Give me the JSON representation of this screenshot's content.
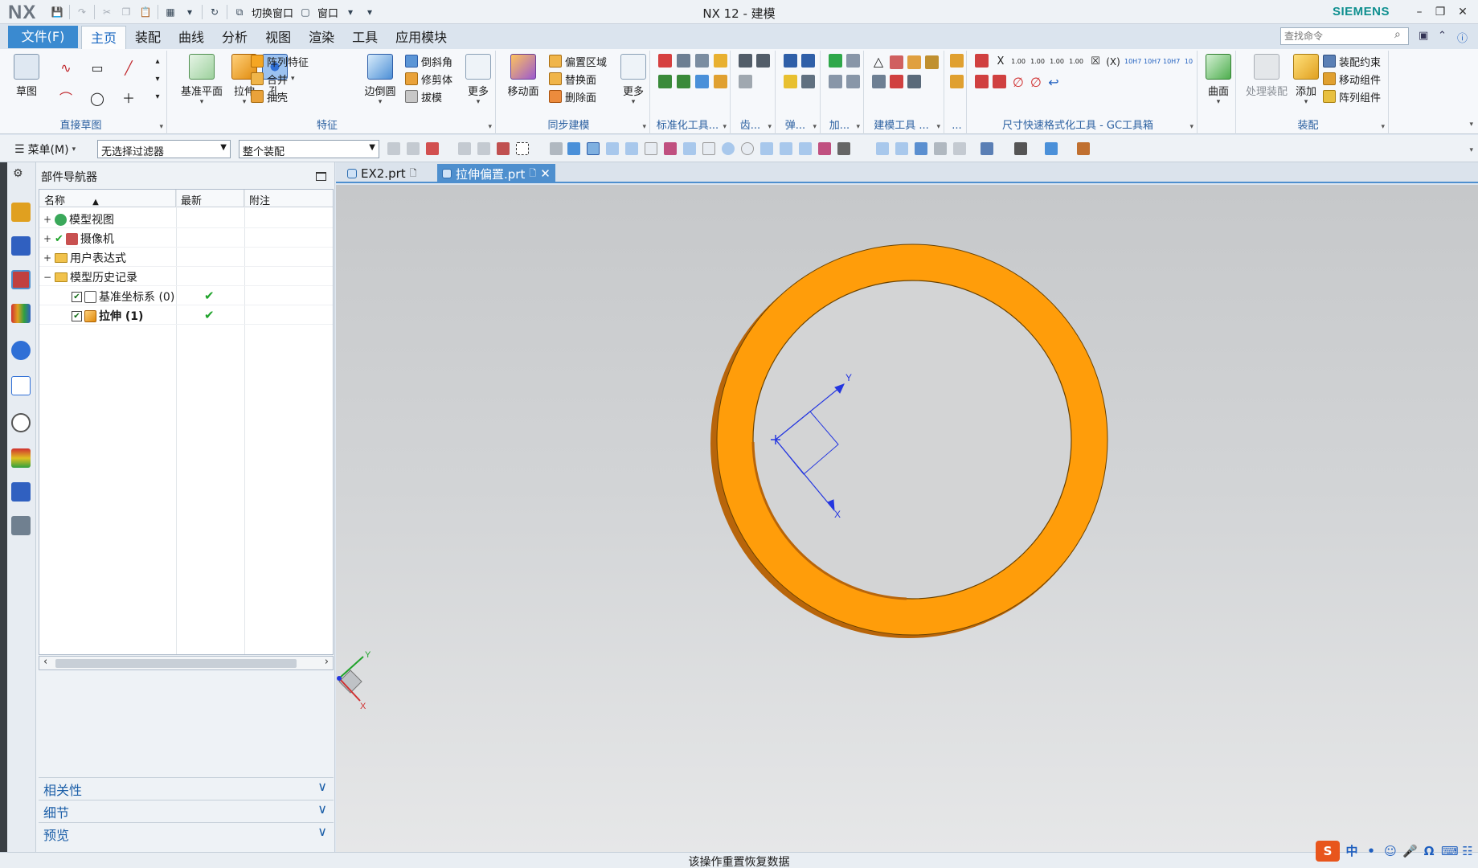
{
  "titlebar": {
    "logo": "NX",
    "title": "NX 12 - 建模",
    "brand": "SIEMENS",
    "switch_window_label": "切换窗口",
    "window_label": "窗口"
  },
  "ribbon_tabs": {
    "file": "文件(F)",
    "tabs": [
      "主页",
      "装配",
      "曲线",
      "分析",
      "视图",
      "渲染",
      "工具",
      "应用模块"
    ],
    "active": "主页",
    "search_placeholder": "查找命令"
  },
  "ribbon": {
    "direct_sketch": {
      "label": "直接草图",
      "sketch": "草图"
    },
    "feature": {
      "label": "特征",
      "datum_plane": "基准平面",
      "extrude": "拉伸",
      "hole": "孔",
      "pattern_feature": "阵列特征",
      "unite": "合并",
      "shell": "抽壳",
      "edge_blend": "边倒圆",
      "chamfer": "倒斜角",
      "trim_body": "修剪体",
      "draft": "拔模",
      "more": "更多"
    },
    "sync_modeling": {
      "label": "同步建模",
      "move_face": "移动面",
      "offset_region": "偏置区域",
      "replace_face": "替换面",
      "delete_face": "删除面",
      "more": "更多"
    },
    "small_groups": [
      "标准化工具...",
      "齿...",
      "弹...",
      "加...",
      "建模工具 ...",
      "..."
    ],
    "gc_toolbox": "尺寸快速格式化工具 - GC工具箱",
    "surface": "曲面",
    "assembly": {
      "label": "装配",
      "process_assembly": "处理装配",
      "add": "添加",
      "assembly_constraint": "装配约束",
      "move_component": "移动组件",
      "pattern_component": "阵列组件"
    }
  },
  "selbar": {
    "menu": "菜单(M)",
    "filter": "无选择过滤器",
    "scope": "整个装配"
  },
  "navigator": {
    "title": "部件导航器",
    "columns": [
      "名称",
      "最新",
      "附注"
    ],
    "rows": [
      {
        "name": "模型视图",
        "expander": "+",
        "latest": ""
      },
      {
        "name": "摄像机",
        "expander": "+",
        "latest": ""
      },
      {
        "name": "用户表达式",
        "expander": "+",
        "latest": ""
      },
      {
        "name": "模型历史记录",
        "expander": "−",
        "latest": ""
      },
      {
        "name": "基准坐标系 (0)",
        "expander": "",
        "latest": "✔"
      },
      {
        "name": "拉伸 (1)",
        "expander": "",
        "latest": "✔"
      }
    ],
    "panels": [
      "相关性",
      "细节",
      "预览"
    ]
  },
  "doc_tabs": [
    {
      "name": "EX2.prt",
      "active": false
    },
    {
      "name": "拉伸偏置.prt",
      "active": true
    }
  ],
  "graphics": {
    "ring_color": "#ff9d0a",
    "ring_shadow": "#b8650a",
    "csys_color": "#2436e0",
    "csys_x": "X",
    "csys_y": "Y",
    "triad_x": "X",
    "triad_y": "Y"
  },
  "status": {
    "message": "该操作重置恢复数据"
  }
}
